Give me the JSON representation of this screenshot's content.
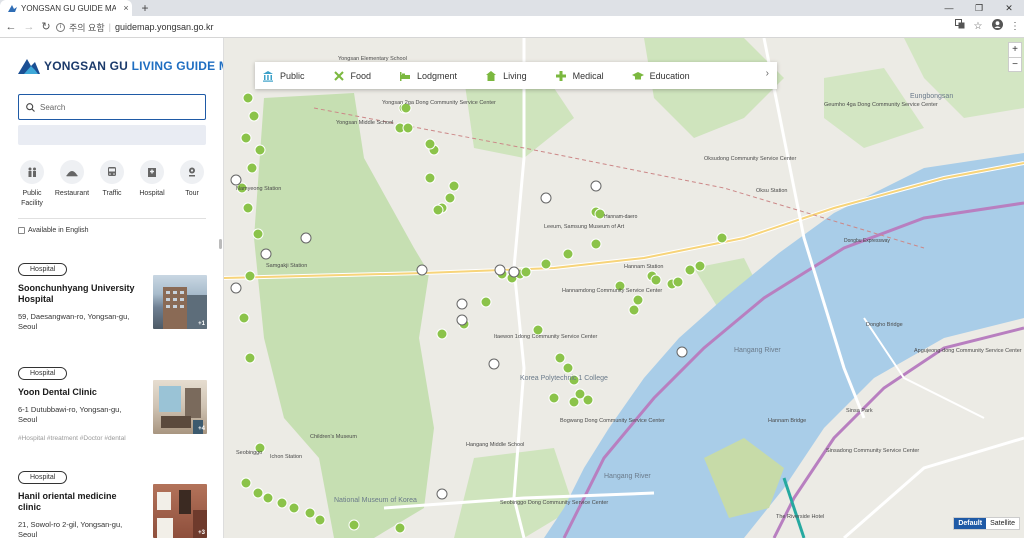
{
  "browser": {
    "tab_title": "YONGSAN GU GUIDE MAP",
    "security_label": "주의 요함",
    "url": "guidemap.yongsan.go.kr"
  },
  "sidebar": {
    "logo_main": "YONGSAN GU",
    "logo_accent": "LIVING GUIDE MAP",
    "search_placeholder": "Search",
    "categories": [
      {
        "label": "Public Facility",
        "icon": "public-facility-icon"
      },
      {
        "label": "Restaurant",
        "icon": "restaurant-icon"
      },
      {
        "label": "Traffic",
        "icon": "bus-icon"
      },
      {
        "label": "Hospital",
        "icon": "hospital-icon"
      },
      {
        "label": "Tour",
        "icon": "tour-icon"
      }
    ],
    "english_filter": "Available in English",
    "results": [
      {
        "category": "Hospital",
        "title": "Soonchunhyang University Hospital",
        "address": "59, Daesangwan-ro, Yongsan-gu, Seoul",
        "tags": "",
        "photo_count": "+1"
      },
      {
        "category": "Hospital",
        "title": "Yoon Dental Clinic",
        "address": "6-1 Dutubbawi-ro, Yongsan-gu, Seoul",
        "tags": "#Hospital #treatment #Doctor #dental",
        "photo_count": "+4"
      },
      {
        "category": "Hospital",
        "title": "Hanil oriental medicine clinic",
        "address": "21, Sowol-ro 2-gil, Yongsan-gu, Seoul",
        "tags": "",
        "photo_count": "+3"
      }
    ]
  },
  "map": {
    "categories": [
      {
        "label": "Public",
        "icon": "building-icon",
        "color": "#3aa0c8"
      },
      {
        "label": "Food",
        "icon": "utensils-icon",
        "color": "#7bb83f"
      },
      {
        "label": "Lodgment",
        "icon": "bed-icon",
        "color": "#7bb83f"
      },
      {
        "label": "Living",
        "icon": "home-icon",
        "color": "#7bb83f"
      },
      {
        "label": "Medical",
        "icon": "cross-icon",
        "color": "#7bb83f"
      },
      {
        "label": "Education",
        "icon": "graduation-icon",
        "color": "#7bb83f"
      }
    ],
    "zoom_in": "+",
    "zoom_out": "−",
    "maptype_default": "Default",
    "maptype_satellite": "Satellite",
    "labels": {
      "yongsan_elementary": "Yongsan Elementary School",
      "yongsan_middle": "Yongsan Middle School",
      "namyeong_station": "Namyeong Station",
      "samgakji_station": "Samgakji Station",
      "itaewon_cc": "Itaewon 1dong Community Service Center",
      "korea_poly": "Korea Polytechnic 1 College",
      "bogwang_cc": "Bogwang Dong Community Service Center",
      "hannam_cc": "Hannamdong Community Service Center",
      "hangang_river": "Hangang River",
      "seobinggo": "Seobinggo",
      "ichon_station": "Ichon Station",
      "national_museum": "National Museum of Korea",
      "childrens_museum": "Children's Museum",
      "hangang_middle": "Hangang Middle School",
      "sinsa_park": "Sinsa Park",
      "apgujeong_cc": "Apgujeong-dong Community Service Center",
      "geumho_cc": "Geumho 4ga Dong Community Service Center",
      "oksu_station": "Oksu Station",
      "dongho_bridge": "Dongho Bridge",
      "hannam_bridge": "Hannam Bridge",
      "yongsan_dong_cc": "Yongsan 2ga Dong Community Service Center",
      "dongbu_expressway": "Dongbu Expressway",
      "hannam_daero": "Hannam-daero",
      "the_riverside": "The Riverside Hotel",
      "sinsadong_cc": "Sinsadong Community Service Center",
      "oksudong_cc": "Oksudong Community Service Center",
      "eungbongsan": "Eungbongsan",
      "seobinggo_cc": "Seobinggo Dong Community Service Center",
      "leeum": "Leeum, Samsung Museum of Art",
      "hannam_station": "Hannam Station"
    }
  }
}
